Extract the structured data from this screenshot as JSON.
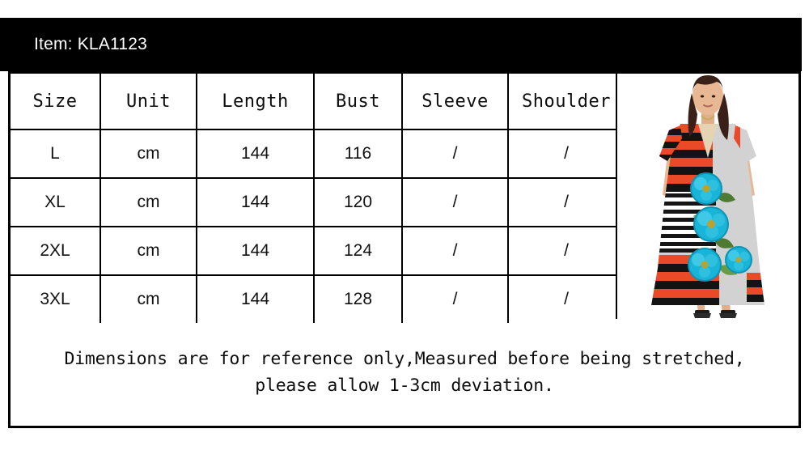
{
  "header": {
    "item_label": "Item: KLA1123"
  },
  "table": {
    "columns": [
      "Size",
      "Unit",
      "Length",
      "Bust",
      "Sleeve",
      "Shoulder"
    ],
    "rows": [
      {
        "size": "L",
        "unit": "cm",
        "length": "144",
        "bust": "116",
        "sleeve": "/",
        "shoulder": "/"
      },
      {
        "size": "XL",
        "unit": "cm",
        "length": "144",
        "bust": "120",
        "sleeve": "/",
        "shoulder": "/"
      },
      {
        "size": "2XL",
        "unit": "cm",
        "length": "144",
        "bust": "124",
        "sleeve": "/",
        "shoulder": "/"
      },
      {
        "size": "3XL",
        "unit": "cm",
        "length": "144",
        "bust": "128",
        "sleeve": "/",
        "shoulder": "/"
      }
    ]
  },
  "note": {
    "line1": "Dimensions are for reference only,Measured before being stretched,",
    "line2": "please allow 1-3cm deviation."
  },
  "photo": {
    "alt": "model-wearing-striped-floral-maxi-dress",
    "colors": {
      "stripe_orange": "#EA4A27",
      "stripe_black": "#131313",
      "panel_gray": "#CFCFCF",
      "flower_teal": "#18B5D8",
      "leaf_green": "#5E8C3A",
      "skin": "#E8B894",
      "hair": "#3A2118"
    }
  },
  "colors": {
    "band_black": "#000000",
    "border_black": "#000000",
    "background": "#FFFFFF",
    "text_dark": "#0D0D0D",
    "text_light": "#FFFFFF"
  }
}
